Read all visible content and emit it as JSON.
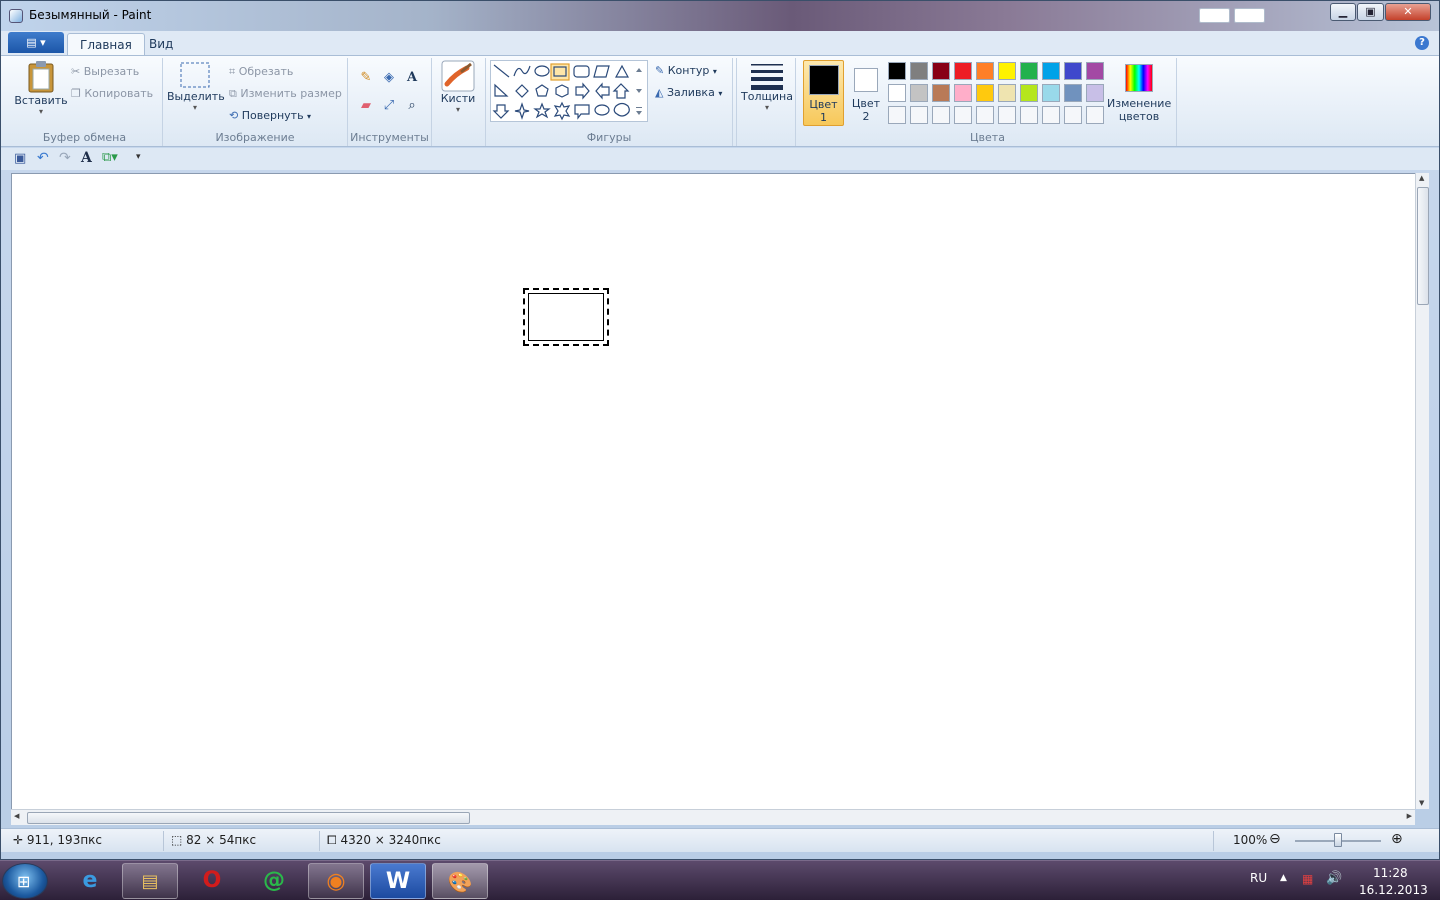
{
  "window": {
    "title": "Безымянный - Paint"
  },
  "tabs": {
    "file_menu_icon": "paint-menu-icon",
    "home": "Главная",
    "view": "Вид"
  },
  "clipboard": {
    "paste": "Вставить",
    "cut": "Вырезать",
    "copy": "Копировать",
    "group_label": "Буфер обмена"
  },
  "image": {
    "select": "Выделить",
    "crop": "Обрезать",
    "resize": "Изменить размер",
    "rotate": "Повернуть",
    "group_label": "Изображение"
  },
  "tools": {
    "group_label": "Инструменты",
    "items": [
      "pencil-icon",
      "fill-icon",
      "text-icon",
      "eraser-icon",
      "color-picker-icon",
      "magnifier-icon"
    ]
  },
  "brushes": {
    "label": "Кисти"
  },
  "shapes": {
    "group_label": "Фигуры",
    "outline": "Контур",
    "fill": "Заливка"
  },
  "size": {
    "label": "Толщина"
  },
  "colors": {
    "color1_a": "Цвет",
    "color1_b": "1",
    "color2_a": "Цвет",
    "color2_b": "2",
    "edit_a": "Изменение",
    "edit_b": "цветов",
    "group_label": "Цвета",
    "color1_value": "#000000",
    "color2_value": "#ffffff",
    "palette_row1": [
      "#000000",
      "#7f7f7f",
      "#880015",
      "#ed1c24",
      "#ff7f27",
      "#fff200",
      "#22b14c",
      "#00a2e8",
      "#3f48cc",
      "#a349a4"
    ],
    "palette_row2": [
      "#ffffff",
      "#c3c3c3",
      "#b97a57",
      "#ffaec9",
      "#ffc90e",
      "#efe4b0",
      "#b5e61d",
      "#99d9ea",
      "#7092be",
      "#c8bfe7"
    ],
    "palette_row3": [
      "#f5f7fa",
      "#f5f7fa",
      "#f5f7fa",
      "#f5f7fa",
      "#f5f7fa",
      "#f5f7fa",
      "#f5f7fa",
      "#f5f7fa",
      "#f5f7fa",
      "#f5f7fa"
    ]
  },
  "status": {
    "cursor": "911, 193пкс",
    "selection": "82 × 54пкс",
    "image_size": "4320 × 3240пкс",
    "zoom": "100%"
  },
  "tray": {
    "lang": "RU",
    "time": "11:28",
    "date": "16.12.2013"
  }
}
